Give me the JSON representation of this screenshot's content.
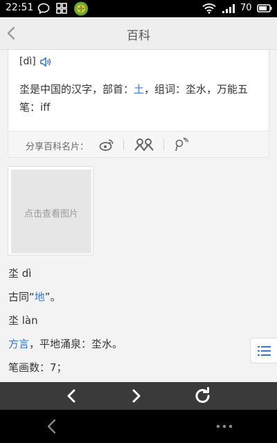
{
  "status_bar": {
    "time": "22:51",
    "battery_level": "70",
    "icons": [
      "chat-bubble-icon",
      "grid-app-icon",
      "app-logo-icon",
      "wifi-icon",
      "signal-icon",
      "battery-icon"
    ]
  },
  "header": {
    "title": "百科"
  },
  "entry": {
    "pinyin": "[dì]",
    "definition_prefix": "坔是中国的汉字，部首：",
    "radical": "土",
    "definition_suffix": "，组词：坔水，万能五笔：iff",
    "share_label": "分享百科名片："
  },
  "image_placeholder": "点击查看图片",
  "content": {
    "line1": "坔 dì",
    "line2_prefix": "古同“",
    "line2_link": "地",
    "line2_suffix": "”。",
    "line3": "坔 làn",
    "line4_link": "方言",
    "line4_suffix": "，平地涌泉：坔水。",
    "line5": "笔画数：7；"
  },
  "colors": {
    "link": "#3a78c7",
    "browser_bar": "#3a3a3a",
    "header_bg": "#eeeeee"
  }
}
